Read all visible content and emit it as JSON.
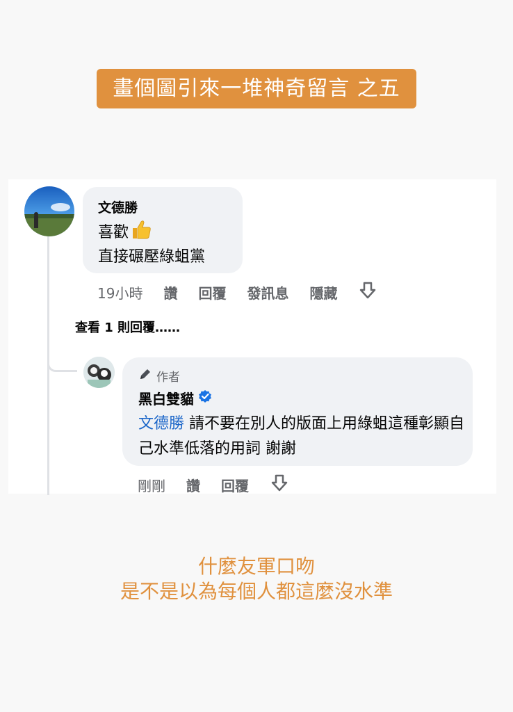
{
  "banner": {
    "text": "畫個圖引來一堆神奇留言 之五"
  },
  "comment": {
    "author": "文德勝",
    "line1": "喜歡",
    "line2": "直接碾壓綠蛆黨",
    "time": "19小時",
    "like": "讚",
    "reply": "回覆",
    "message": "發訊息",
    "hide": "隱藏",
    "view_replies": "查看 1 則回覆……"
  },
  "reply": {
    "badge": "作者",
    "author": "黑白雙貓",
    "mention": "文德勝",
    "text": " 請不要在別人的版面上用綠蛆這種彰顯自己水準低落的用詞 謝謝",
    "time": "剛剛",
    "like": "讚",
    "reply": "回覆"
  },
  "caption": {
    "line1": "什麼友軍口吻",
    "line2": "是不是以為每個人都這麼沒水準"
  },
  "colors": {
    "accent": "#e0913e",
    "mention": "#1b66c9",
    "verified": "#1b74e4"
  }
}
